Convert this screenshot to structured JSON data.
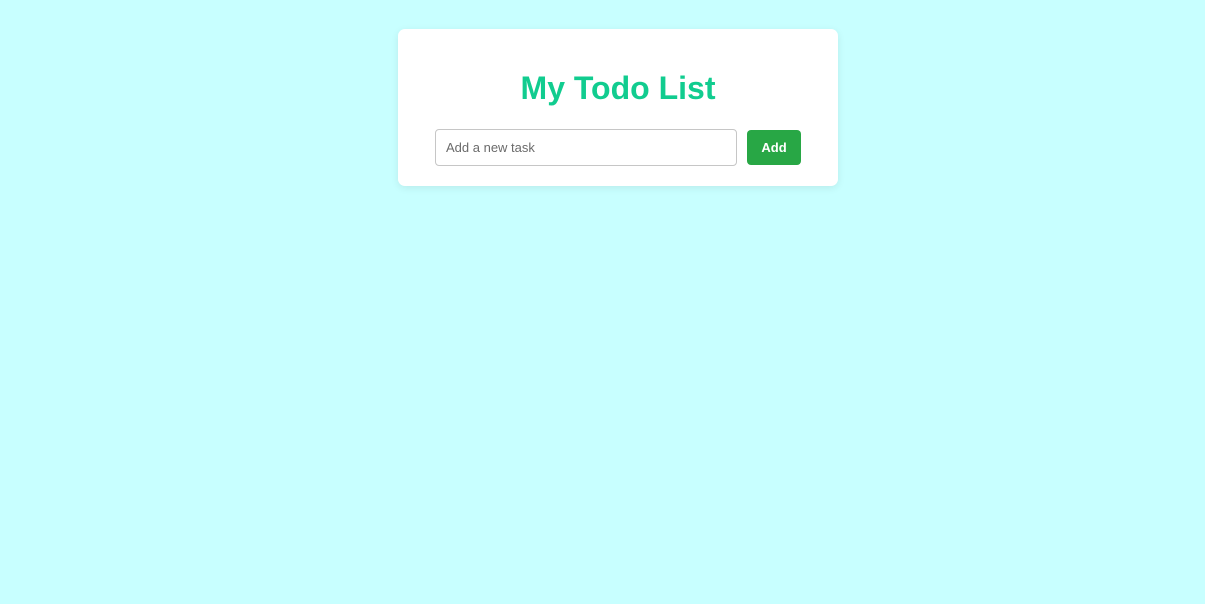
{
  "app": {
    "title": "My Todo List"
  },
  "task_form": {
    "input_value": "",
    "input_placeholder": "Add a new task",
    "add_label": "Add"
  },
  "colors": {
    "background": "#c8ffff",
    "title": "#11cc8f",
    "add_button": "#28a745"
  }
}
